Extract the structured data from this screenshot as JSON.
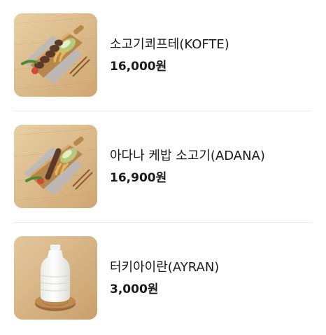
{
  "menu": {
    "items": [
      {
        "name": "소고기쾨프테(KOFTE)",
        "price": "16,000원",
        "image_icon": "kofte-plate-photo"
      },
      {
        "name": "아다나 케밥 소고기(ADANA)",
        "price": "16,900원",
        "image_icon": "adana-kebab-plate-photo"
      },
      {
        "name": "터키아이란(AYRAN)",
        "price": "3,000원",
        "image_icon": "ayran-bottle-photo"
      }
    ]
  },
  "colors": {
    "wood_light": "#e2c497",
    "wood_dark": "#c99d64",
    "divider": "#ececec",
    "text": "#1a1a1a"
  }
}
